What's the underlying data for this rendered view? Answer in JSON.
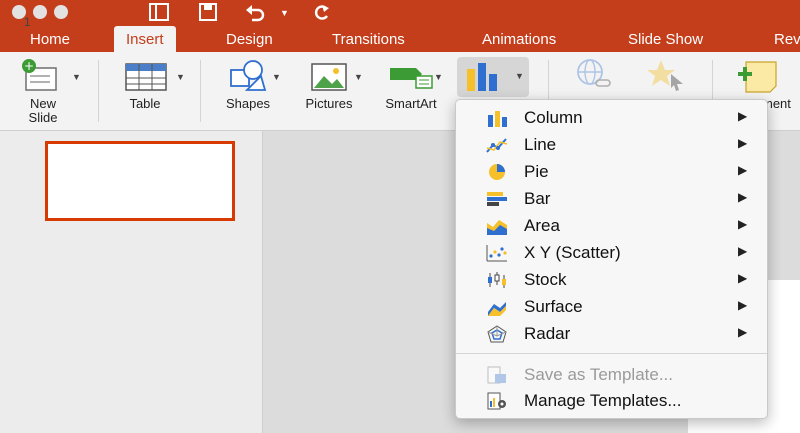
{
  "colors": {
    "accent": "#c43e1c",
    "selection": "#d83b01",
    "chart_blue": "#2f6fcf",
    "chart_yellow": "#f5c02a"
  },
  "tabs": [
    "Home",
    "Insert",
    "Design",
    "Transitions",
    "Animations",
    "Slide Show",
    "Rev"
  ],
  "active_tab": "Insert",
  "ribbon": {
    "new_slide_line1": "New",
    "new_slide_line2": "Slide",
    "table": "Table",
    "shapes": "Shapes",
    "pictures": "Pictures",
    "smartart": "SmartArt",
    "comment_partial": "ment"
  },
  "slides": {
    "number": "1"
  },
  "chart_menu": {
    "items": [
      {
        "label": "Column",
        "icon": "column-chart-icon"
      },
      {
        "label": "Line",
        "icon": "line-chart-icon"
      },
      {
        "label": "Pie",
        "icon": "pie-chart-icon"
      },
      {
        "label": "Bar",
        "icon": "bar-chart-icon"
      },
      {
        "label": "Area",
        "icon": "area-chart-icon"
      },
      {
        "label": "X Y (Scatter)",
        "icon": "scatter-chart-icon"
      },
      {
        "label": "Stock",
        "icon": "stock-chart-icon"
      },
      {
        "label": "Surface",
        "icon": "surface-chart-icon"
      },
      {
        "label": "Radar",
        "icon": "radar-chart-icon"
      }
    ],
    "save_template": "Save as Template...",
    "manage_templates": "Manage Templates..."
  }
}
